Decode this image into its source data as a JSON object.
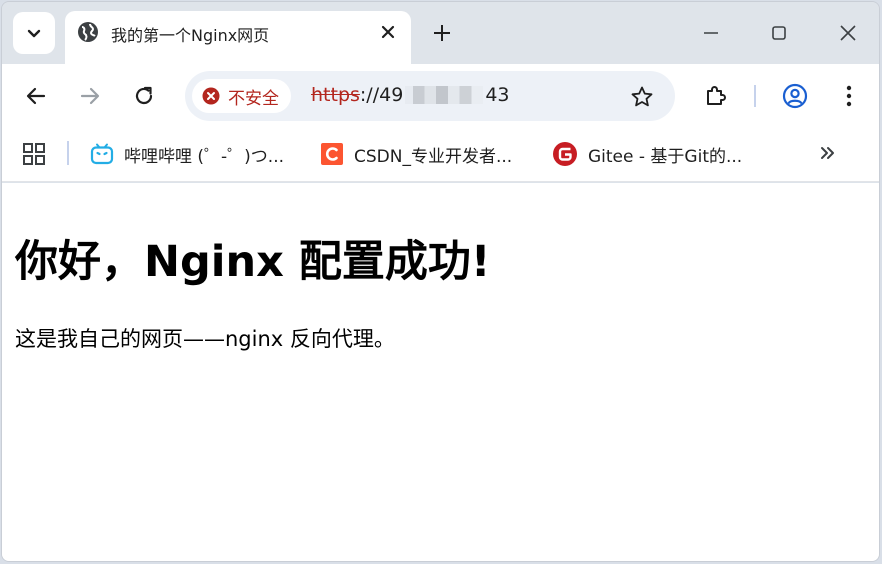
{
  "tab": {
    "title": "我的第一个Nginx网页"
  },
  "omnibox": {
    "security_label": "不安全",
    "url_scheme": "https",
    "url_sep": "://",
    "url_start": "49",
    "url_end": "43"
  },
  "bookmarks": [
    {
      "label": "哔哩哔哩 (゜-゜)つ...",
      "icon": "bilibili-icon"
    },
    {
      "label": "CSDN_专业开发者...",
      "icon": "csdn-icon"
    },
    {
      "label": "Gitee - 基于Git的...",
      "icon": "gitee-icon"
    }
  ],
  "page": {
    "heading": "你好，Nginx 配置成功!",
    "paragraph": "这是我自己的网页——nginx 反向代理。"
  },
  "colors": {
    "insecure": "#b3261e",
    "profile": "#1a5fd1",
    "bilibili": "#23ade5",
    "csdn": "#fc5531",
    "gitee": "#c71d23"
  }
}
